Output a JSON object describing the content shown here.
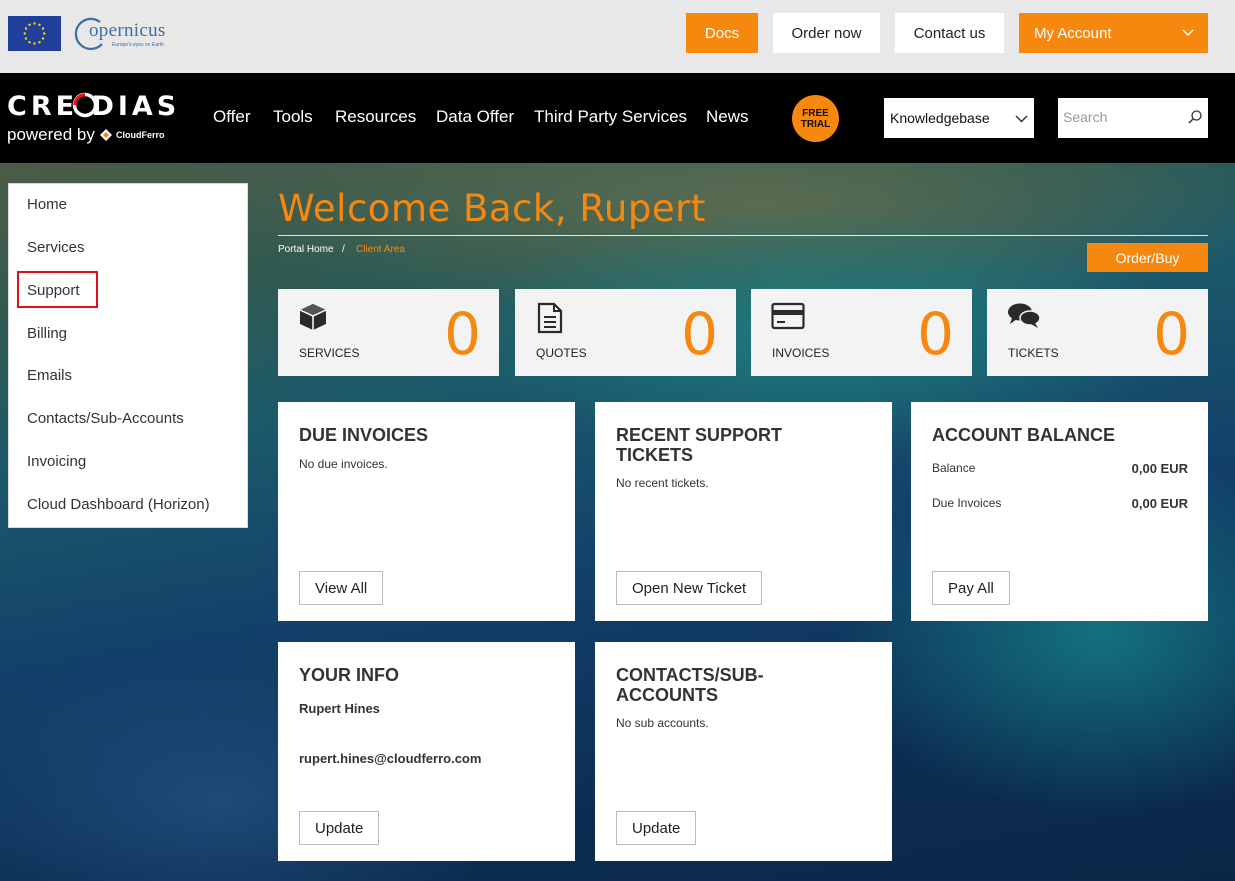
{
  "colors": {
    "accent": "#f7880f",
    "highlight": "#e0101a",
    "nav_bg": "#000000",
    "topbar_bg": "#e8e8e8"
  },
  "topbar": {
    "copernicus": {
      "name": "opernicus",
      "tagline": "Europe's eyes on Earth"
    },
    "docs": "Docs",
    "order_now": "Order now",
    "contact_us": "Contact us",
    "my_account": "My Account"
  },
  "nav": {
    "logo": "CRE DIAS",
    "powered_by": "powered by",
    "cloudferro": "CloudFerro",
    "items": [
      "Offer",
      "Tools",
      "Resources",
      "Data Offer",
      "Third Party Services",
      "News"
    ],
    "free_trial": [
      "FREE",
      "TRIAL"
    ],
    "knowledgebase": "Knowledgebase",
    "search_placeholder": "Search"
  },
  "sidebar": {
    "items": [
      "Home",
      "Services",
      "Support",
      "Billing",
      "Emails",
      "Contacts/Sub-Accounts",
      "Invoicing",
      "Cloud Dashboard (Horizon)"
    ],
    "highlighted": "Support"
  },
  "main": {
    "welcome": "Welcome Back, Rupert",
    "breadcrumb": {
      "home": "Portal Home",
      "sep": "/",
      "current": "Client Area"
    },
    "order_buy": "Order/Buy",
    "stats": [
      {
        "icon": "cube-icon",
        "label": "SERVICES",
        "value": "0"
      },
      {
        "icon": "document-icon",
        "label": "QUOTES",
        "value": "0"
      },
      {
        "icon": "credit-card-icon",
        "label": "INVOICES",
        "value": "0"
      },
      {
        "icon": "chat-bubbles-icon",
        "label": "TICKETS",
        "value": "0"
      }
    ],
    "due_invoices": {
      "title": "DUE INVOICES",
      "text": "No due invoices.",
      "button": "View All"
    },
    "support_tickets": {
      "title": "RECENT SUPPORT TICKETS",
      "text": "No recent tickets.",
      "button": "Open New Ticket"
    },
    "account_balance": {
      "title": "ACCOUNT BALANCE",
      "balance_label": "Balance",
      "balance_value": "0,00 EUR",
      "due_label": "Due Invoices",
      "due_value": "0,00 EUR",
      "button": "Pay All"
    },
    "your_info": {
      "title": "YOUR INFO",
      "name": "Rupert Hines",
      "email": "rupert.hines@cloudferro.com",
      "button": "Update"
    },
    "contacts": {
      "title": "CONTACTS/SUB-ACCOUNTS",
      "text": "No sub accounts.",
      "button": "Update"
    }
  }
}
